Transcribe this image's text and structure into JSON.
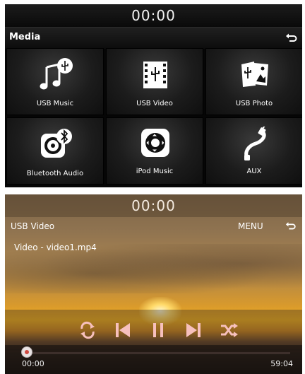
{
  "media_screen": {
    "clock": "00:00",
    "title": "Media",
    "tiles": [
      {
        "label": "USB Music",
        "icon": "usb-music-icon"
      },
      {
        "label": "USB Video",
        "icon": "usb-video-icon"
      },
      {
        "label": "USB Photo",
        "icon": "usb-photo-icon"
      },
      {
        "label": "Bluetooth Audio",
        "icon": "bluetooth-audio-icon"
      },
      {
        "label": "iPod Music",
        "icon": "ipod-music-icon"
      },
      {
        "label": "AUX",
        "icon": "aux-cable-icon"
      }
    ]
  },
  "video_screen": {
    "clock": "00:00",
    "title": "USB Video",
    "menu_label": "MENU",
    "file_label": "Video - video1.mp4",
    "controls": [
      "repeat-icon",
      "previous-icon",
      "pause-icon",
      "next-icon",
      "shuffle-icon"
    ],
    "current_time": "00:00",
    "total_time": "59:04",
    "progress": 0.0
  },
  "colors": {
    "progress_fill": "#d4544b",
    "icon_white": "#ffffff"
  }
}
